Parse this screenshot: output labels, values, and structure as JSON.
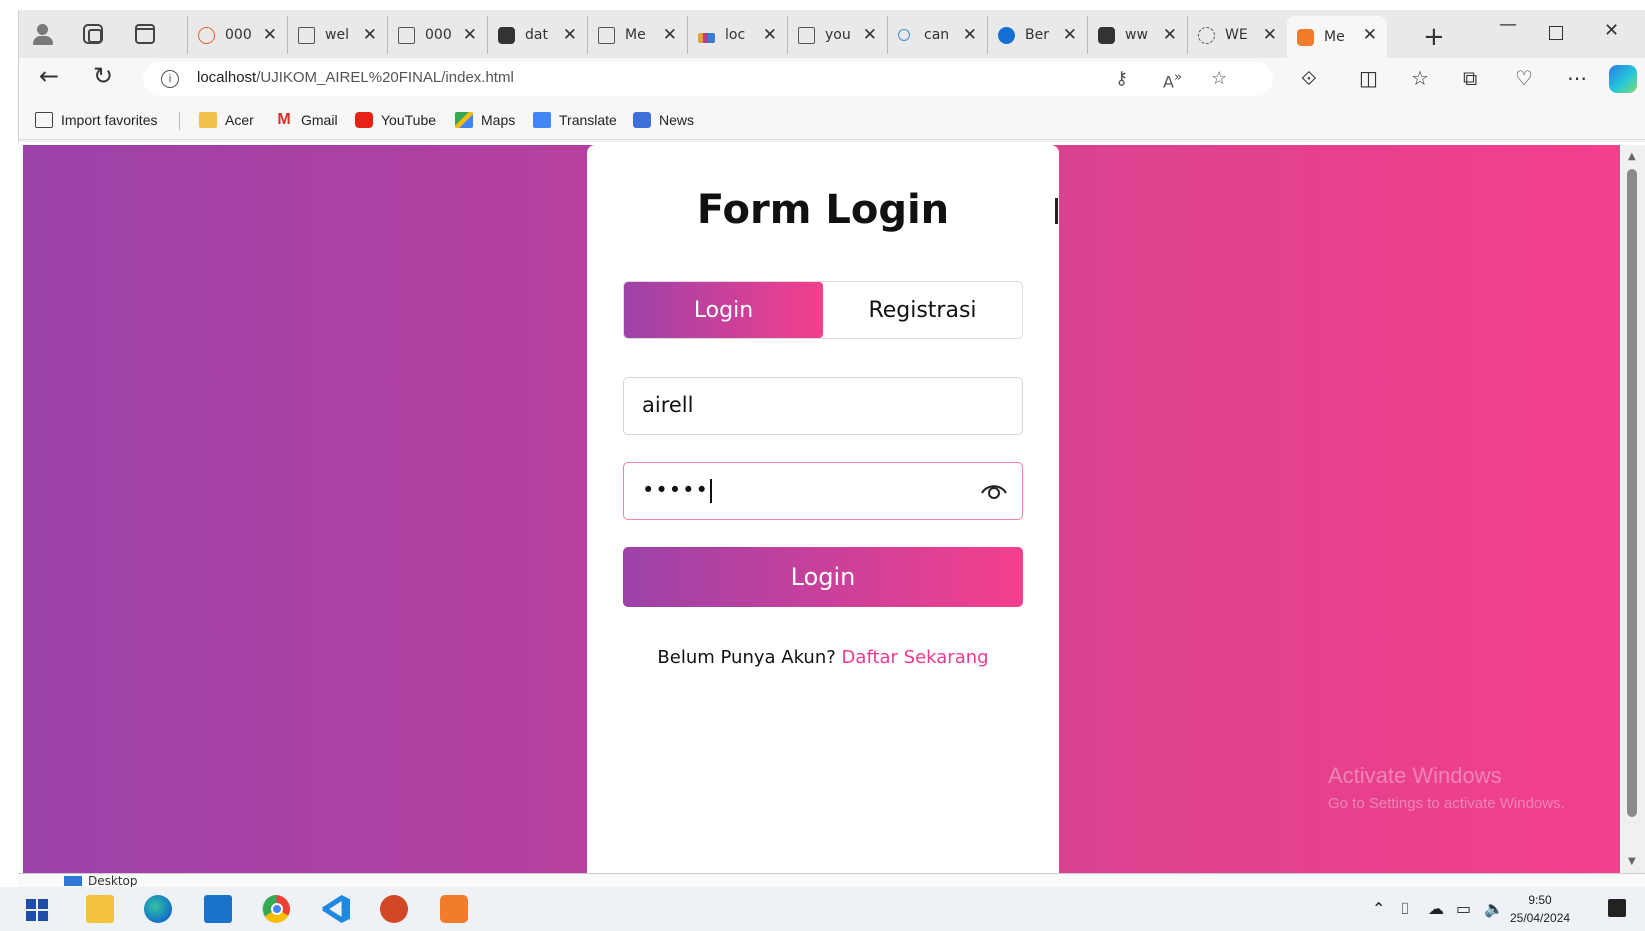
{
  "browser": {
    "tabs": [
      {
        "title": "000",
        "favicon": "orange-spiral-icon",
        "active": false
      },
      {
        "title": "wel",
        "favicon": "page-icon",
        "active": false
      },
      {
        "title": "000",
        "favicon": "page-icon",
        "active": false
      },
      {
        "title": "dat",
        "favicon": "lock-page-icon",
        "active": false
      },
      {
        "title": "Me",
        "favicon": "page-icon",
        "active": false
      },
      {
        "title": "loc",
        "favicon": "phpmyadmin-icon",
        "active": false
      },
      {
        "title": "you",
        "favicon": "page-icon",
        "active": false
      },
      {
        "title": "can",
        "favicon": "search-icon",
        "active": false
      },
      {
        "title": "Ber",
        "favicon": "blue-circle-icon",
        "active": false
      },
      {
        "title": "ww",
        "favicon": "lock-page-icon",
        "active": false
      },
      {
        "title": "WE",
        "favicon": "dotted-circle-icon",
        "active": false
      },
      {
        "title": "Me",
        "favicon": "xampp-icon",
        "active": true
      }
    ],
    "url_host": "localhost",
    "url_path": "/UJIKOM_AIREL%20FINAL/index.html",
    "bookmarks": [
      {
        "label": "Import favorites",
        "icon": "import-icon"
      },
      {
        "label": "Acer",
        "icon": "folder-icon"
      },
      {
        "label": "Gmail",
        "icon": "gmail-icon"
      },
      {
        "label": "YouTube",
        "icon": "youtube-icon"
      },
      {
        "label": "Maps",
        "icon": "maps-icon"
      },
      {
        "label": "Translate",
        "icon": "translate-icon"
      },
      {
        "label": "News",
        "icon": "news-icon"
      }
    ]
  },
  "page": {
    "title": "Form Login",
    "tabs": {
      "login": "Login",
      "register": "Registrasi"
    },
    "username_value": "airell",
    "password_masked": "•••••",
    "submit_label": "Login",
    "footer_prompt": "Belum Punya Akun?",
    "footer_link": "Daftar Sekarang",
    "colors": {
      "gradient_start": "#9c42a8",
      "gradient_end": "#f43f8d",
      "link": "#ef3a8f"
    }
  },
  "watermark": {
    "line1": "Activate Windows",
    "line2": "Go to Settings to activate Windows."
  },
  "strip": {
    "label": "Desktop"
  },
  "taskbar": {
    "time": "9:50",
    "date": "25/04/2024"
  }
}
